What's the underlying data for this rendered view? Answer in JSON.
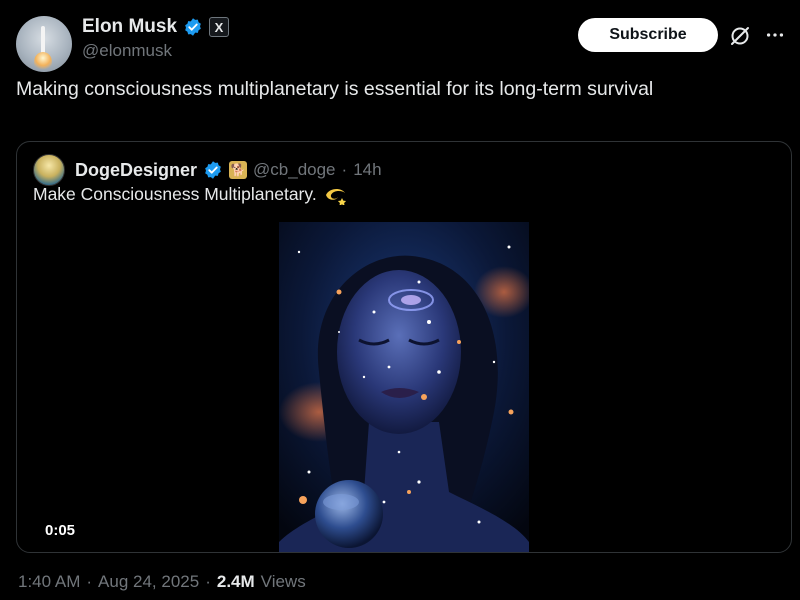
{
  "author": {
    "name": "Elon Musk",
    "handle": "@elonmusk",
    "badge": "X"
  },
  "actions": {
    "subscribe_label": "Subscribe"
  },
  "post": {
    "text": "Making consciousness multiplanetary is essential for its long-term survival"
  },
  "quoted": {
    "name": "DogeDesigner",
    "handle": "@cb_doge",
    "separator": "·",
    "time": "14h",
    "text": "Make Consciousness Multiplanetary.",
    "video_duration": "0:05"
  },
  "meta": {
    "time": "1:40 AM",
    "sep1": "·",
    "date": "Aug 24, 2025",
    "sep2": "·",
    "views_count": "2.4M",
    "views_label": "Views"
  },
  "colors": {
    "background": "#000000",
    "text": "#e7e9ea",
    "muted": "#71767b",
    "verified": "#1d9bf0",
    "border": "#2f3336"
  }
}
